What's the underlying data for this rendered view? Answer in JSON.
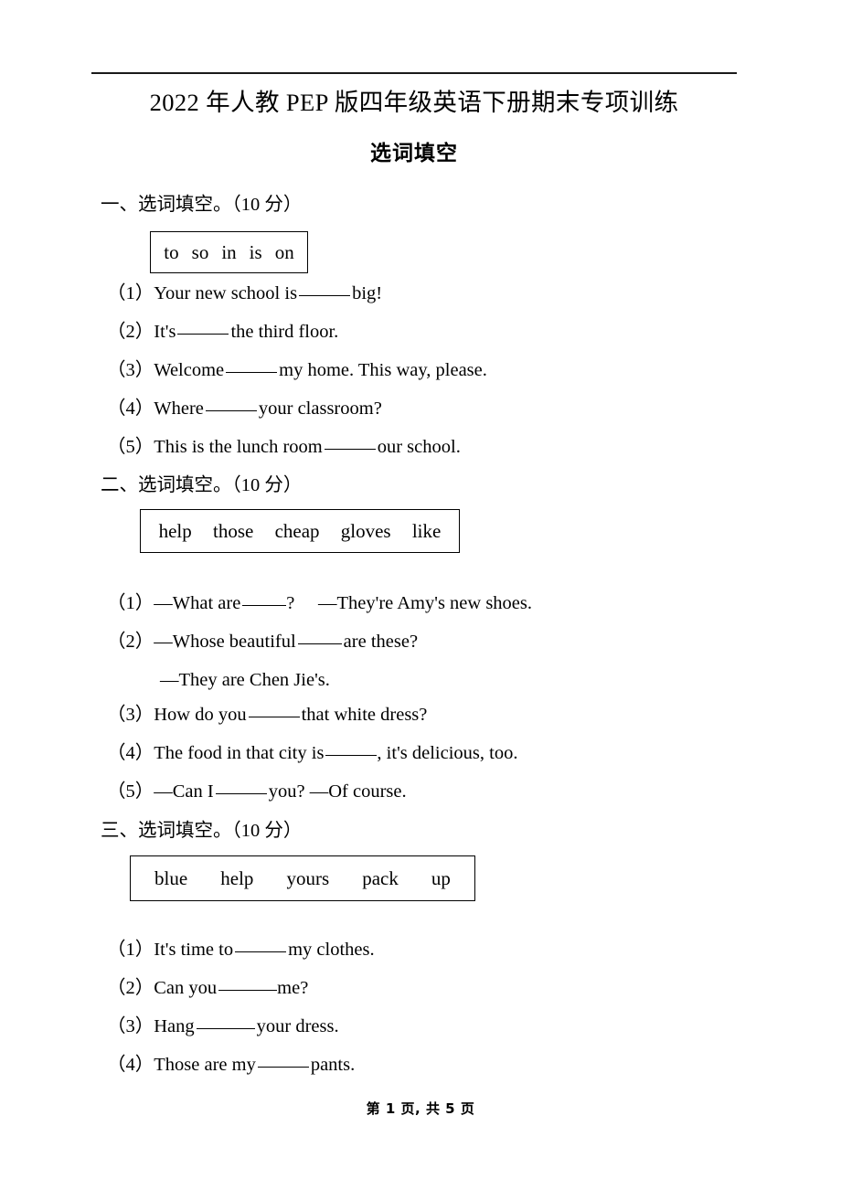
{
  "document": {
    "title": "2022 年人教 PEP 版四年级英语下册期末专项训练",
    "subtitle": "选词填空"
  },
  "sections": [
    {
      "heading": "一、选词填空。（10 分）",
      "wordbank": [
        "to",
        "so",
        "in",
        "is",
        "on"
      ],
      "questions": [
        {
          "num": "（1）",
          "before": "Your new school is",
          "after": "big!"
        },
        {
          "num": "（2）",
          "before": "It's",
          "after": "the third floor."
        },
        {
          "num": "（3）",
          "before": "Welcome",
          "after": "my home. This way, please."
        },
        {
          "num": "（4）",
          "before": "Where",
          "after": "your classroom?"
        },
        {
          "num": "（5）",
          "before": "This is the lunch room",
          "after": "our school."
        }
      ]
    },
    {
      "heading": "二、选词填空。（10 分）",
      "wordbank": [
        "help",
        "those",
        "cheap",
        "gloves",
        "like"
      ],
      "questions": [
        {
          "num": "（1）",
          "before": "—What are",
          "after": "?  —They're Amy's new shoes."
        },
        {
          "num": "（2）",
          "before": "—Whose beautiful",
          "after": "are these?"
        },
        {
          "num": "",
          "cont": true,
          "text": "—They are Chen Jie's."
        },
        {
          "num": "（3）",
          "before": "How do you",
          "after": "that white dress?"
        },
        {
          "num": "（4）",
          "before": "The food in that city is",
          "after": ", it's delicious, too."
        },
        {
          "num": "（5）",
          "before": "—Can I",
          "after": "you? —Of course."
        }
      ]
    },
    {
      "heading": "三、选词填空。（10 分）",
      "wordbank": [
        "blue",
        "help",
        "yours",
        "pack",
        "up"
      ],
      "questions": [
        {
          "num": "（1）",
          "before": "It's time to",
          "after": "my clothes."
        },
        {
          "num": "（2）",
          "before": "Can you",
          "after": "me?"
        },
        {
          "num": "（3）",
          "before": "Hang",
          "after": "your dress."
        },
        {
          "num": "（4）",
          "before": "Those are my",
          "after": "pants."
        }
      ]
    }
  ],
  "footer": {
    "text": "第 1 页, 共 5 页"
  }
}
